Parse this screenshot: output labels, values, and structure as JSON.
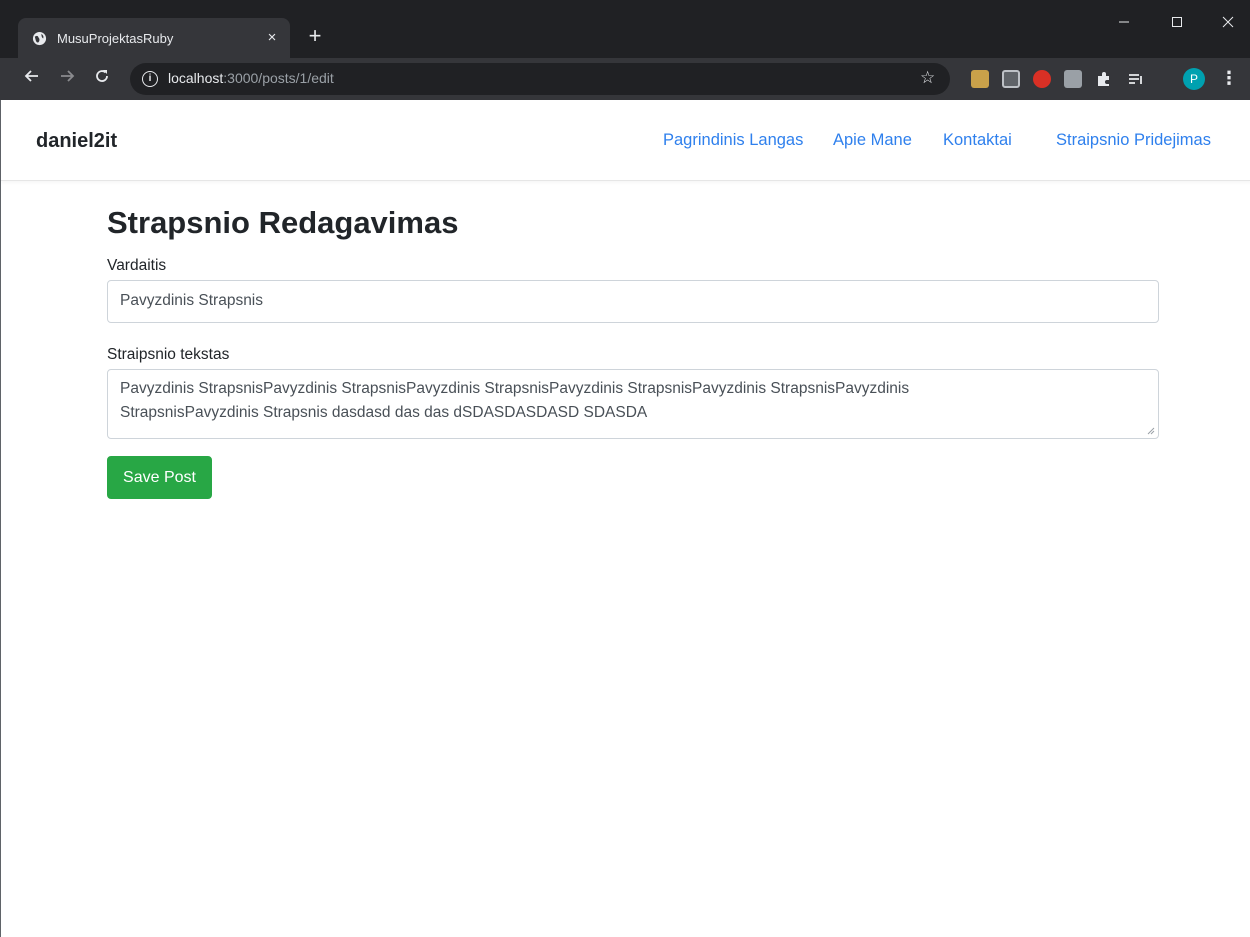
{
  "browser": {
    "tab_title": "MusuProjektasRuby",
    "tab_close": "×",
    "new_tab": "+",
    "url_host": "localhost",
    "url_path": ":3000/posts/1/edit",
    "profile_initial": "P"
  },
  "navbar": {
    "brand": "daniel2it",
    "links": [
      "Pagrindinis Langas",
      "Apie Mane",
      "Kontaktai",
      "Straipsnio Pridejimas"
    ]
  },
  "form": {
    "title": "Strapsnio Redagavimas",
    "name_label": "Vardaitis",
    "name_value": "Pavyzdinis Strapsnis",
    "text_label": "Straipsnio tekstas",
    "text_value_line1": "Pavyzdinis StrapsnisPavyzdinis StrapsnisPavyzdinis StrapsnisPavyzdinis StrapsnisPavyzdinis StrapsnisPavyzdinis",
    "text_value_line2": "StrapsnisPavyzdinis Strapsnis dasdasd das das dSDASDASDASD SDASDA",
    "save_label": "Save Post"
  },
  "colors": {
    "link": "#2f80ed",
    "button": "#28a745",
    "chrome_dark": "#202124",
    "chrome_toolbar": "#35363a"
  }
}
